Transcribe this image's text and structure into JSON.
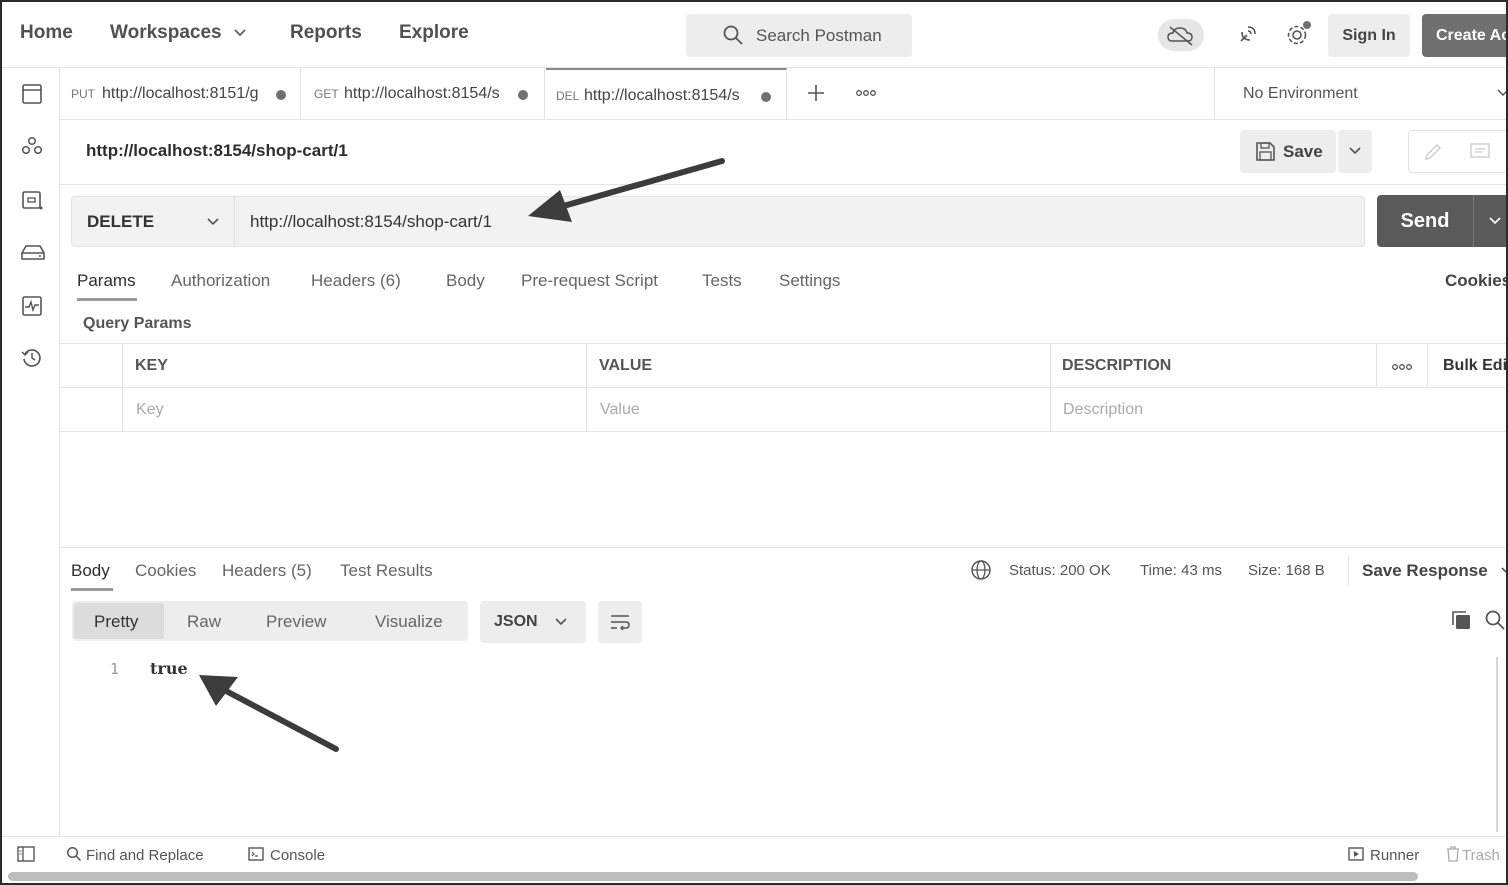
{
  "nav": {
    "home": "Home",
    "workspaces": "Workspaces",
    "reports": "Reports",
    "explore": "Explore",
    "search_placeholder": "Search Postman",
    "sign_in": "Sign In",
    "create_account": "Create Account"
  },
  "sidebar": {
    "icons": [
      "collections-icon",
      "apis-icon",
      "environments-icon",
      "mock-servers-icon",
      "monitors-icon",
      "history-icon"
    ]
  },
  "tabs": [
    {
      "method": "PUT",
      "url": "http://localhost:8151/g"
    },
    {
      "method": "GET",
      "url": "http://localhost:8154/s"
    },
    {
      "method": "DEL",
      "url": "http://localhost:8154/s"
    }
  ],
  "environment": "No Environment",
  "request": {
    "title": "http://localhost:8154/shop-cart/1",
    "save_label": "Save",
    "method": "DELETE",
    "url": "http://localhost:8154/shop-cart/1",
    "send_label": "Send"
  },
  "request_tabs": {
    "params": "Params",
    "authorization": "Authorization",
    "headers": "Headers (6)",
    "body": "Body",
    "pre_request": "Pre-request Script",
    "tests": "Tests",
    "settings": "Settings",
    "cookies": "Cookies"
  },
  "query_params": {
    "title": "Query Params",
    "col_key": "KEY",
    "col_value": "VALUE",
    "col_description": "DESCRIPTION",
    "bulk_edit": "Bulk Edit",
    "ph_key": "Key",
    "ph_value": "Value",
    "ph_description": "Description"
  },
  "response": {
    "tabs": {
      "body": "Body",
      "cookies": "Cookies",
      "headers": "Headers (5)",
      "test_results": "Test Results"
    },
    "status": "Status: 200 OK",
    "time": "Time: 43 ms",
    "size": "Size: 168 B",
    "save_response": "Save Response",
    "formats": {
      "pretty": "Pretty",
      "raw": "Raw",
      "preview": "Preview",
      "visualize": "Visualize"
    },
    "language": "JSON",
    "line_number": "1",
    "body_value": "true"
  },
  "footer": {
    "find_replace": "Find and Replace",
    "console": "Console",
    "runner": "Runner",
    "trash": "Trash"
  },
  "colors": {
    "send_button": "#5a5a5a",
    "annotation_arrow": "#3c3c3c"
  }
}
